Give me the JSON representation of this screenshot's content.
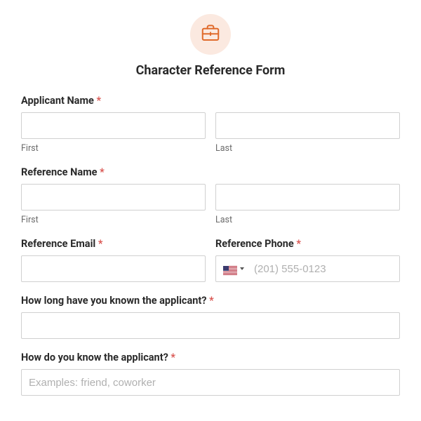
{
  "header": {
    "icon": "briefcase-icon",
    "title": "Character Reference Form"
  },
  "required_mark": "*",
  "fields": {
    "applicant_name": {
      "label": "Applicant Name",
      "first_sub": "First",
      "last_sub": "Last"
    },
    "reference_name": {
      "label": "Reference Name",
      "first_sub": "First",
      "last_sub": "Last"
    },
    "reference_email": {
      "label": "Reference Email"
    },
    "reference_phone": {
      "label": "Reference Phone",
      "placeholder": "(201) 555-0123",
      "country": "US"
    },
    "how_long": {
      "label": "How long have you known the applicant?"
    },
    "how_know": {
      "label": "How do you know the applicant?",
      "placeholder": "Examples: friend, coworker"
    }
  }
}
